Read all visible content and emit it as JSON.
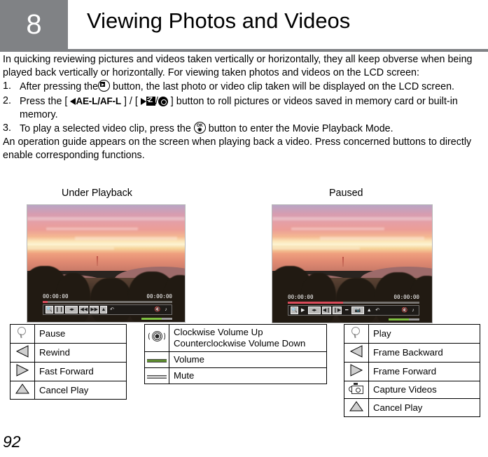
{
  "header": {
    "chapter_number": "8",
    "title": "Viewing Photos and Videos",
    "block_color": "#808285"
  },
  "body": {
    "intro": "In quicking reviewing pictures and videos taken vertically or horizontally, they all keep obverse when being played back vertically or horizontally. For viewing taken photos and videos on the LCD screen:",
    "steps": [
      {
        "num": "1.",
        "text_before": "After pressing the",
        "icon": "play-circle-icon",
        "text_after": "button, the last photo or video clip taken will be displayed on the LCD screen."
      },
      {
        "num": "2.",
        "text_before": "Press the [",
        "icon_left": "left-triangle-icon",
        "label_ael": "AE-L/AF-L",
        "text_mid": "] / [",
        "icon_right": "right-triangle-icon",
        "icon_ev": "exposure-compensation-icon",
        "icon_slash": "/",
        "icon_aperture": "aperture-icon",
        "text_after": "] button to roll pictures or videos saved in memory card or built-in memory."
      },
      {
        "num": "3.",
        "text_before": "To play a selected video clip, press the",
        "icon": "ok-button-icon",
        "text_after": "button to enter the Movie Playback Mode."
      }
    ],
    "outro": "An operation guide appears on the screen when playing back a video. Press concerned buttons to directly enable corresponding functions."
  },
  "figures": {
    "left": {
      "caption": "Under Playback",
      "osd": {
        "time_elapsed": "00:00:00",
        "time_total": "00:00:00",
        "progress_percent": 4,
        "progress_color": "#d94a5a",
        "volume_percent": 66,
        "volume_color": "#7fc142",
        "buttons": [
          "magnifier-icon",
          "pause-icon",
          "volume-adjust-icon",
          "rewind-icon",
          "fast-forward-icon",
          "up-arrow-icon",
          "return-arrow-icon",
          "mute-icon",
          "music-note-icon"
        ]
      }
    },
    "right": {
      "caption": "Paused",
      "osd": {
        "time_elapsed": "00:00:00",
        "time_total": "00:00:00",
        "progress_percent": 42,
        "progress_color": "#d94a5a",
        "volume_percent": 66,
        "volume_color": "#7fc142",
        "buttons": [
          "magnifier-icon",
          "play-icon",
          "volume-adjust-icon",
          "frame-backward-icon",
          "frame-forward-icon",
          "line-icon",
          "capture-icon",
          "up-arrow-icon",
          "return-arrow-icon",
          "mute-icon",
          "music-note-icon"
        ]
      }
    }
  },
  "tables": {
    "left": {
      "rows": [
        {
          "icon": "magnifier-icon",
          "label": "Pause"
        },
        {
          "icon": "left-triangle-icon",
          "label": "Rewind"
        },
        {
          "icon": "right-triangle-icon",
          "label": "Fast Forward"
        },
        {
          "icon": "up-triangle-icon",
          "label": "Cancel Play"
        }
      ]
    },
    "middle": {
      "rows": [
        {
          "icon": "dial-wheel-icon",
          "label": "Clockwise Volume Up Counterclockwise Volume Down"
        },
        {
          "icon": "green-line-icon",
          "label": "Volume"
        },
        {
          "icon": "gray-line-icon",
          "label": "Mute"
        }
      ]
    },
    "right": {
      "rows": [
        {
          "icon": "magnifier-icon",
          "label": "Play"
        },
        {
          "icon": "left-triangle-icon",
          "label": "Frame Backward"
        },
        {
          "icon": "right-triangle-icon",
          "label": "Frame Forward"
        },
        {
          "icon": "camera-icon",
          "label": "Capture Videos"
        },
        {
          "icon": "up-triangle-icon",
          "label": "Cancel Play"
        }
      ]
    }
  },
  "footer": {
    "page_number": "92"
  }
}
